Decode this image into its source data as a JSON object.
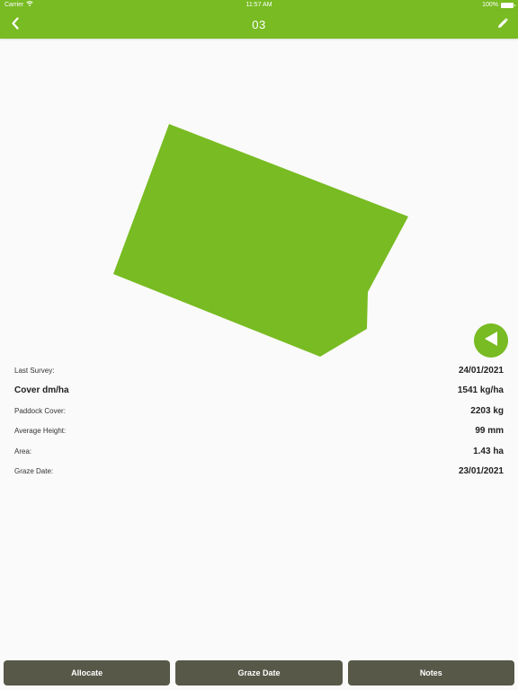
{
  "status_bar": {
    "carrier": "Carrier",
    "time": "11:57 AM",
    "battery": "100%",
    "wifi_icon": "wifi-icon",
    "battery_icon": "battery-icon"
  },
  "nav": {
    "title": "03",
    "back_icon": "chevron-left-icon",
    "edit_icon": "pencil-icon"
  },
  "map": {
    "paddock_color": "#78bb22",
    "nav_arrow_icon": "triangle-left-icon"
  },
  "info": [
    {
      "label": "Last Survey:",
      "value": "24/01/2021",
      "emphasis": false
    },
    {
      "label": "Cover dm/ha",
      "value": "1541 kg/ha",
      "emphasis": true
    },
    {
      "label": "Paddock Cover:",
      "value": "2203 kg",
      "emphasis": false
    },
    {
      "label": "Average Height:",
      "value": "99 mm",
      "emphasis": false
    },
    {
      "label": "Area:",
      "value": "1.43 ha",
      "emphasis": false
    },
    {
      "label": "Graze Date:",
      "value": "23/01/2021",
      "emphasis": false
    }
  ],
  "buttons": {
    "allocate": "Allocate",
    "graze_date": "Graze Date",
    "notes": "Notes"
  },
  "colors": {
    "accent": "#78bb22",
    "button_bg": "#575848",
    "background": "#fafafa"
  }
}
